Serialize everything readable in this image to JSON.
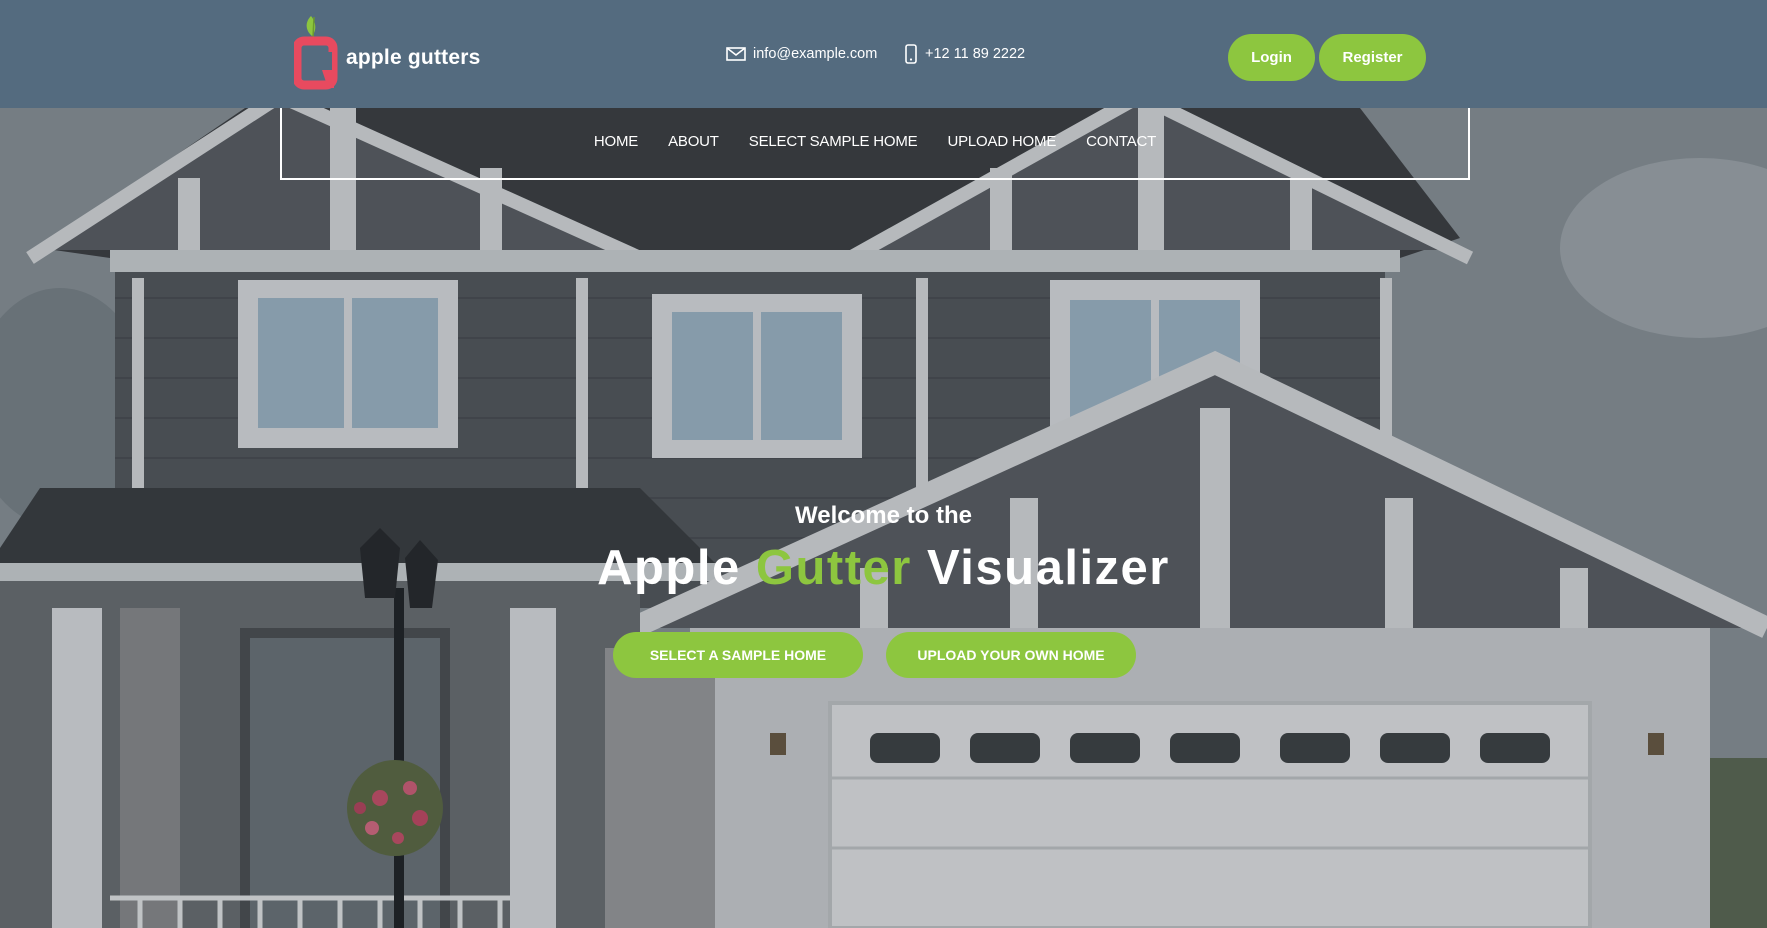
{
  "brand": {
    "name": "apple gutters",
    "logo_color": "#e84a5f",
    "leaf_color": "#8dc63f"
  },
  "header": {
    "email": "info@example.com",
    "phone": "+12 11 89 2222",
    "email_icon": "envelope-icon",
    "phone_icon": "mobile-phone-icon",
    "login_label": "Login",
    "register_label": "Register"
  },
  "nav": {
    "items": [
      {
        "label": "HOME"
      },
      {
        "label": "ABOUT"
      },
      {
        "label": "SELECT SAMPLE HOME"
      },
      {
        "label": "UPLOAD HOME"
      },
      {
        "label": "CONTACT"
      }
    ]
  },
  "hero": {
    "welcome": "Welcome to the",
    "title_part1": "Apple",
    "title_accent": "Gutter",
    "title_part2": "Visualizer",
    "cta_sample": "SELECT A SAMPLE HOME",
    "cta_upload": "UPLOAD YOUR OWN HOME"
  },
  "colors": {
    "header_bg": "#546b7f",
    "accent": "#8dc63f",
    "text": "#ffffff"
  }
}
